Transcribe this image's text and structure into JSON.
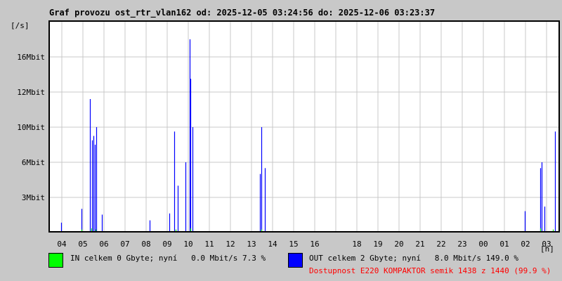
{
  "chart_data": {
    "type": "bar",
    "title": "Graf provozu ost_rtr_vlan162 od: 2025-12-05 03:24:56 do: 2025-12-06 03:23:37",
    "ylabel": "[/s]",
    "xlabel": "[h]",
    "y_ticks": [
      "3Mbit",
      "6Mbit",
      "10Mbit",
      "12Mbit",
      "16Mbit"
    ],
    "y_tick_values": [
      3,
      6,
      10,
      12,
      16
    ],
    "x_ticks": [
      "04",
      "05",
      "06",
      "07",
      "08",
      "09",
      "10",
      "11",
      "12",
      "13",
      "14",
      "15",
      "16",
      "",
      "18",
      "19",
      "20",
      "21",
      "22",
      "23",
      "00",
      "01",
      "02",
      "03"
    ],
    "grid": true,
    "series": [
      {
        "name": "OUT",
        "color": "#0000ff",
        "unit": "Mbit/s",
        "points": [
          [
            3.97,
            0.8
          ],
          [
            4.93,
            2.0
          ],
          [
            5.33,
            11.6
          ],
          [
            5.43,
            8.5
          ],
          [
            5.5,
            9.0
          ],
          [
            5.55,
            8.0
          ],
          [
            5.63,
            10.0
          ],
          [
            5.9,
            1.5
          ],
          [
            8.17,
            1.0
          ],
          [
            9.1,
            1.6
          ],
          [
            9.33,
            9.5
          ],
          [
            9.5,
            4.0
          ],
          [
            9.87,
            6.0
          ],
          [
            10.07,
            18.0
          ],
          [
            10.1,
            13.5
          ],
          [
            10.2,
            10.0
          ],
          [
            13.4,
            5.0
          ],
          [
            13.47,
            10.0
          ],
          [
            13.63,
            5.5
          ],
          [
            25.97,
            1.8
          ],
          [
            26.7,
            5.5
          ],
          [
            26.77,
            6.0
          ],
          [
            26.9,
            2.2
          ],
          [
            27.4,
            9.5
          ]
        ]
      },
      {
        "name": "IN",
        "color": "#00ff00",
        "unit": "Mbit/s",
        "points": [
          [
            4.93,
            0.2
          ],
          [
            5.4,
            0.3
          ],
          [
            5.6,
            0.2
          ],
          [
            9.4,
            0.2
          ],
          [
            10.1,
            0.3
          ],
          [
            13.47,
            0.2
          ],
          [
            26.7,
            0.3
          ],
          [
            27.3,
            0.2
          ]
        ]
      }
    ]
  },
  "legend": {
    "in_text": "IN celkem 0 Gbyte; nyní   0.0 Mbit/s 7.3 %",
    "out_text": "OUT celkem 2 Gbyte; nyní   8.0 Mbit/s 149.0 %",
    "availability": "Dostupnost E220 KOMPAKTOR semik 1438 z 1440 (99.9 %)",
    "in_color": "#00ff00",
    "out_color": "#0000ff"
  }
}
